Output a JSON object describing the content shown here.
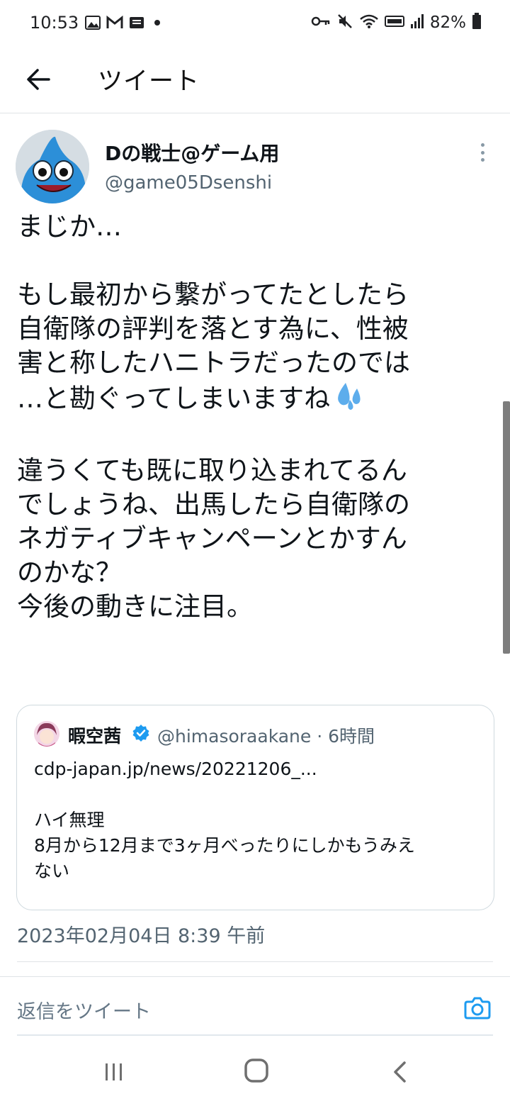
{
  "status_bar": {
    "time": "10:53",
    "battery": "82%",
    "left_icons": [
      "gallery-icon",
      "gmail-icon",
      "document-icon",
      "dot-icon"
    ],
    "right_icons": [
      "key-icon",
      "mute-icon",
      "wifi-icon",
      "volte-icon",
      "signal-icon",
      "battery-icon"
    ]
  },
  "header": {
    "title": "ツイート",
    "back_icon": "arrow-left-icon"
  },
  "tweet": {
    "author_name": "Dの戦士@ゲーム用",
    "author_handle": "@game05Dsenshi",
    "lines": [
      "まじか…",
      "",
      "もし最初から繋がってたとしたら",
      "自衛隊の評判を落とす為に、性被",
      "害と称したハニトラだったのでは",
      "…と勘ぐってしまいますね",
      "",
      "違うくても既に取り込まれてるん",
      "でしょうね、出馬したら自衛隊の",
      "ネガティブキャンペーンとかすん",
      "のかな？",
      "今後の動きに注目。"
    ],
    "emoji": "sweat-droplets-icon",
    "timestamp": "2023年02月04日 8:39 午前"
  },
  "quote": {
    "author_name": "暇空茜",
    "author_handle": "@himasoraakane",
    "separator": "·",
    "time_ago": "6時間",
    "lines": [
      "cdp-japan.jp/news/20221206_...",
      "",
      "ハイ無理",
      "8月から12月まで3ヶ月べったりにしかもうみえ",
      "ない"
    ],
    "verified_icon": "verified-badge-icon"
  },
  "reply": {
    "placeholder": "返信をツイート",
    "camera_icon": "camera-icon"
  },
  "nav": {
    "icons": [
      "recent-apps-icon",
      "home-icon",
      "back-icon"
    ]
  },
  "colors": {
    "accent": "#1d9bf0",
    "text_primary": "#0f1419",
    "text_secondary": "#536471",
    "border": "#cfd9de"
  }
}
